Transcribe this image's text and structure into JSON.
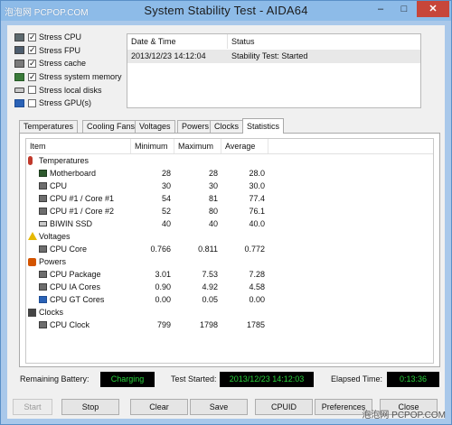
{
  "window": {
    "title": "System Stability Test - AIDA64",
    "watermark": "泡泡网 PCPOP.COM",
    "watermark_bottom": "泡泡网 PCPOP.COM",
    "min_glyph": "–",
    "max_glyph": "□",
    "close_glyph": "✕"
  },
  "checks": [
    {
      "label": "Stress CPU",
      "checked": true,
      "icon": "cpu-icon"
    },
    {
      "label": "Stress FPU",
      "checked": true,
      "icon": "fpu-icon"
    },
    {
      "label": "Stress cache",
      "checked": true,
      "icon": "cache-icon"
    },
    {
      "label": "Stress system memory",
      "checked": true,
      "icon": "memory-icon"
    },
    {
      "label": "Stress local disks",
      "checked": false,
      "icon": "disk-icon"
    },
    {
      "label": "Stress GPU(s)",
      "checked": false,
      "icon": "gpu-icon"
    }
  ],
  "status": {
    "columns": [
      "Date & Time",
      "Status"
    ],
    "rows": [
      {
        "datetime": "2013/12/23 14:12:04",
        "status": "Stability Test: Started"
      }
    ]
  },
  "tabs": [
    {
      "label": "Temperatures"
    },
    {
      "label": "Cooling Fans"
    },
    {
      "label": "Voltages"
    },
    {
      "label": "Powers"
    },
    {
      "label": "Clocks"
    },
    {
      "label": "Statistics",
      "active": true
    }
  ],
  "stats": {
    "columns": {
      "item": "Item",
      "min": "Minimum",
      "max": "Maximum",
      "avg": "Average"
    },
    "groups": [
      {
        "category": "Temperatures",
        "icon": "thermometer-icon",
        "rows": [
          {
            "name": "Motherboard",
            "icon": "motherboard-icon",
            "min": "28",
            "max": "28",
            "avg": "28.0"
          },
          {
            "name": "CPU",
            "icon": "cpu-icon",
            "min": "30",
            "max": "30",
            "avg": "30.0"
          },
          {
            "name": "CPU #1 / Core #1",
            "icon": "cpu-icon",
            "min": "54",
            "max": "81",
            "avg": "77.4"
          },
          {
            "name": "CPU #1 / Core #2",
            "icon": "cpu-icon",
            "min": "52",
            "max": "80",
            "avg": "76.1"
          },
          {
            "name": "BIWIN SSD",
            "icon": "ssd-icon",
            "min": "40",
            "max": "40",
            "avg": "40.0"
          }
        ]
      },
      {
        "category": "Voltages",
        "icon": "warning-icon",
        "rows": [
          {
            "name": "CPU Core",
            "icon": "cpu-icon",
            "min": "0.766",
            "max": "0.811",
            "avg": "0.772"
          }
        ]
      },
      {
        "category": "Powers",
        "icon": "power-icon",
        "rows": [
          {
            "name": "CPU Package",
            "icon": "cpu-icon",
            "min": "3.01",
            "max": "7.53",
            "avg": "7.28"
          },
          {
            "name": "CPU IA Cores",
            "icon": "cpu-icon",
            "min": "0.90",
            "max": "4.92",
            "avg": "4.58"
          },
          {
            "name": "CPU GT Cores",
            "icon": "gpu-icon",
            "min": "0.00",
            "max": "0.05",
            "avg": "0.00"
          }
        ]
      },
      {
        "category": "Clocks",
        "icon": "clock-icon",
        "rows": [
          {
            "name": "CPU Clock",
            "icon": "cpu-icon",
            "min": "799",
            "max": "1798",
            "avg": "1785"
          }
        ]
      }
    ]
  },
  "info": {
    "battery_label": "Remaining Battery:",
    "battery_value": "Charging",
    "test_label": "Test Started:",
    "test_value": "2013/12/23 14:12:03",
    "elapsed_label": "Elapsed Time:",
    "elapsed_value": "0:13:36"
  },
  "buttons": {
    "start": "Start",
    "stop": "Stop",
    "clear": "Clear",
    "save": "Save",
    "cpuid": "CPUID",
    "preferences": "Preferences",
    "close": "Close"
  },
  "colors": {
    "title_bar": "#8dbbe8",
    "close_button": "#c7463a",
    "readout_bg": "#000000",
    "readout_text": "#28d33b",
    "selected_row": "#e8e8e8"
  }
}
